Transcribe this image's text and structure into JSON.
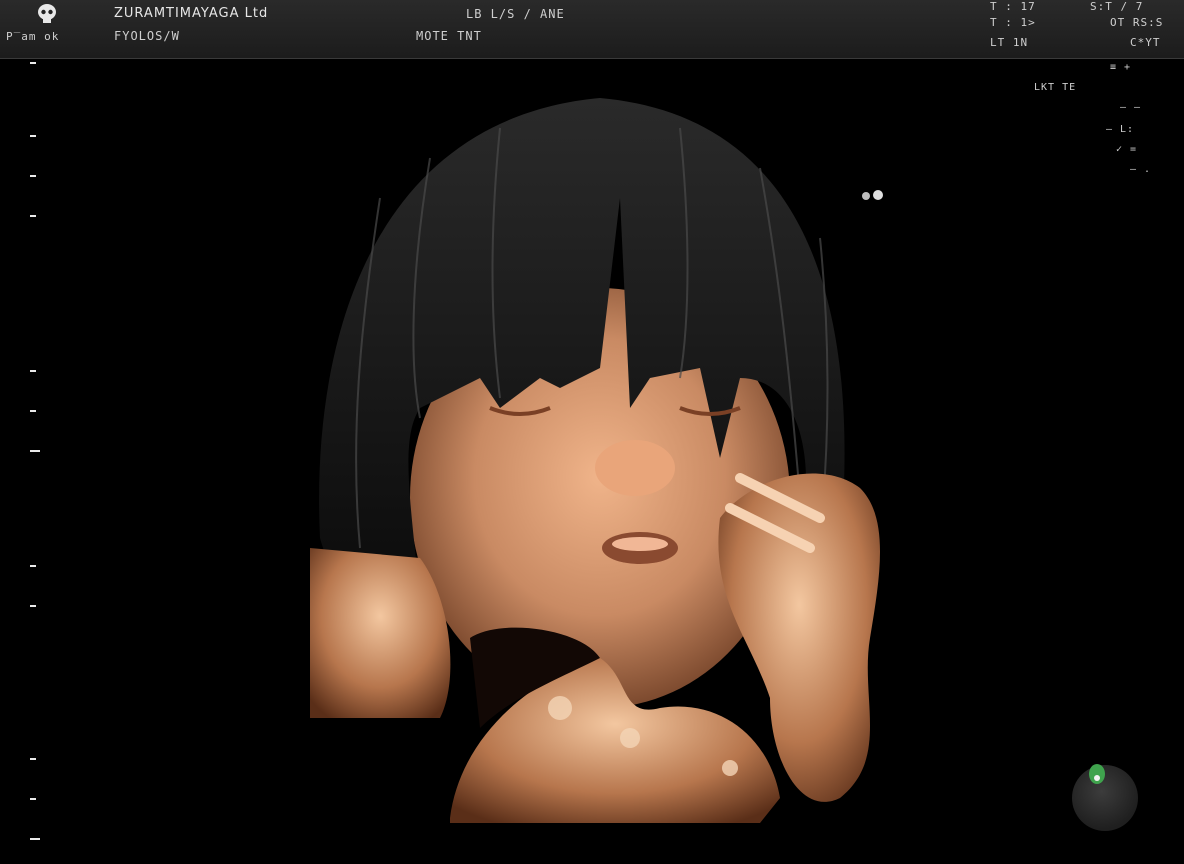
{
  "header": {
    "left_line1": "",
    "left_line2": "P‾am ok",
    "title": "ZURAMTIMAYAGA Ltd",
    "subtitle": "FYOLOS/W",
    "center_line1": "LB  L/S / ANE",
    "center_line2": "MOTE  TNT",
    "right_col1": [
      "T : 17",
      "T : 1>",
      "LT 1N"
    ],
    "right_col2": [
      "S:T / 7",
      "OT RS:S",
      "C*YT"
    ]
  },
  "side_panel": {
    "lines": [
      "≡  +",
      "LKT  TE",
      "—  —",
      "—  L:",
      "✓  =",
      "—  ."
    ]
  },
  "icons": {
    "logo": "skull-logo-icon",
    "orientation": "orientation-indicator-icon",
    "scene": "fetal-3d-render"
  },
  "colors": {
    "background": "#000000",
    "topbar": "#222222",
    "skin": "#c98a63",
    "hair": "#1a1a1a",
    "marker": "#3fa34d"
  }
}
